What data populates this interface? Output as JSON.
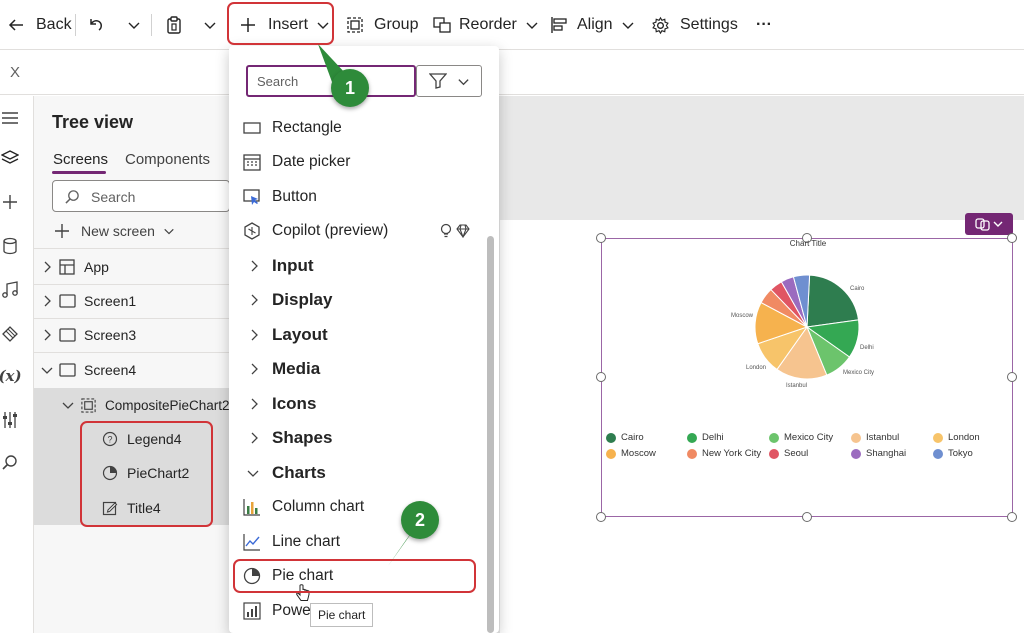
{
  "toolbar": {
    "back_label": "Back",
    "insert_label": "Insert",
    "group_label": "Group",
    "reorder_label": "Reorder",
    "align_label": "Align",
    "settings_label": "Settings",
    "more_label": "···"
  },
  "formula_bar": {
    "property_value": "X"
  },
  "tree_view": {
    "title": "Tree view",
    "tabs": [
      {
        "label": "Screens"
      },
      {
        "label": "Components"
      }
    ],
    "search_placeholder": "Search",
    "new_screen_label": "New screen",
    "items": [
      {
        "label": "App"
      },
      {
        "label": "Screen1"
      },
      {
        "label": "Screen3"
      },
      {
        "label": "Screen4"
      },
      {
        "label": "CompositePieChart2"
      },
      {
        "label": "Legend4"
      },
      {
        "label": "PieChart2"
      },
      {
        "label": "Title4"
      }
    ]
  },
  "insert_menu": {
    "search_placeholder": "Search",
    "items": [
      {
        "label": "Rectangle"
      },
      {
        "label": "Date picker"
      },
      {
        "label": "Button"
      },
      {
        "label": "Copilot (preview)"
      },
      {
        "label": "Input"
      },
      {
        "label": "Display"
      },
      {
        "label": "Layout"
      },
      {
        "label": "Media"
      },
      {
        "label": "Icons"
      },
      {
        "label": "Shapes"
      },
      {
        "label": "Charts"
      },
      {
        "label": "Column chart"
      },
      {
        "label": "Line chart"
      },
      {
        "label": "Pie chart"
      },
      {
        "label": "Powe"
      }
    ],
    "tooltip": "Pie chart"
  },
  "callouts": {
    "step1": "1",
    "step2": "2"
  },
  "chart": {
    "title": "Chart Title",
    "slice_labels": [
      "Cairo",
      "Delhi",
      "Mexico City",
      "Istanbul",
      "London",
      "Moscow"
    ],
    "legend": [
      {
        "label": "Cairo",
        "color": "#2e7d4f"
      },
      {
        "label": "Delhi",
        "color": "#34a853"
      },
      {
        "label": "Mexico City",
        "color": "#6cc46c"
      },
      {
        "label": "Istanbul",
        "color": "#f6c48f"
      },
      {
        "label": "London",
        "color": "#f7c46a"
      },
      {
        "label": "Moscow",
        "color": "#f6b24e"
      },
      {
        "label": "New York City",
        "color": "#f08a63"
      },
      {
        "label": "Seoul",
        "color": "#e05563"
      },
      {
        "label": "Shanghai",
        "color": "#9b6bbf"
      },
      {
        "label": "Tokyo",
        "color": "#6f8fd0"
      }
    ]
  }
}
